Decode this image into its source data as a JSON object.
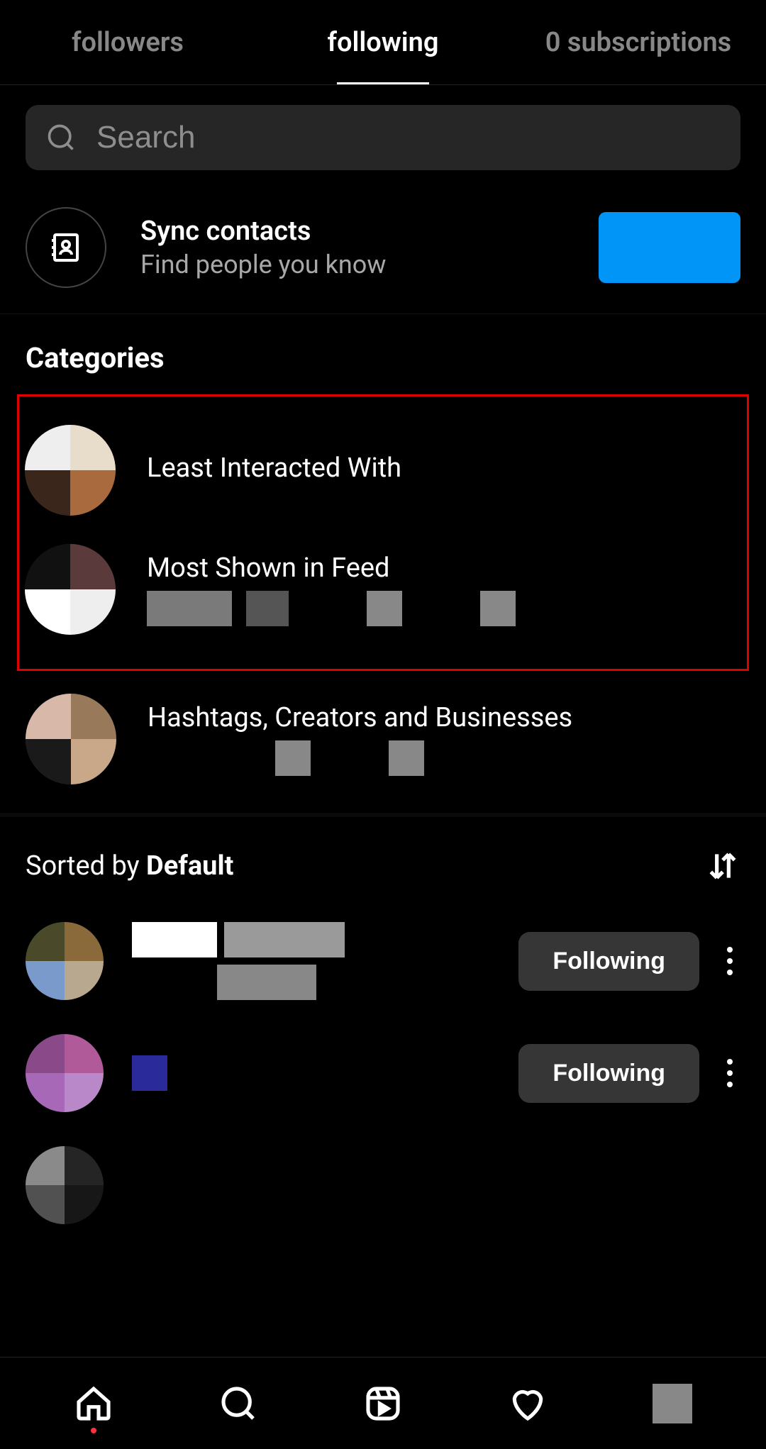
{
  "tabs": {
    "followers": "followers",
    "following": "following",
    "subscriptions": "0 subscriptions"
  },
  "search": {
    "placeholder": "Search"
  },
  "sync": {
    "title": "Sync contacts",
    "subtitle": "Find people you know"
  },
  "categories": {
    "heading": "Categories",
    "items": [
      {
        "title": "Least Interacted With",
        "subtitle": ""
      },
      {
        "title": "Most Shown in Feed",
        "subtitle": ""
      },
      {
        "title": "Hashtags, Creators and Businesses",
        "subtitle": ""
      }
    ]
  },
  "sorted": {
    "prefix": "Sorted by ",
    "mode": "Default"
  },
  "followButton": "Following",
  "rows": [
    {
      "button": "Following"
    },
    {
      "button": "Following"
    }
  ]
}
